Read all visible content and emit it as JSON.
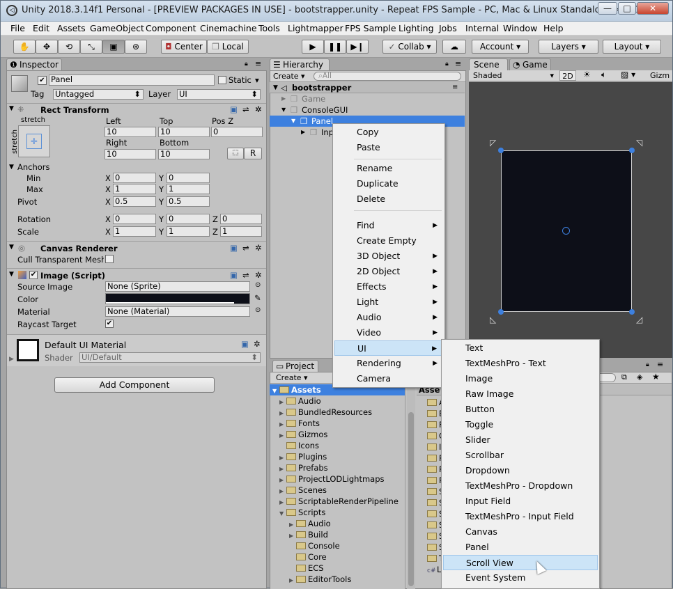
{
  "window": {
    "title": "Unity 2018.3.14f1 Personal - [PREVIEW PACKAGES IN USE] - bootstrapper.unity - Repeat FPS Sample - PC, Mac & Linux Standalone <DX11>",
    "controls": [
      "—",
      "□",
      "✕"
    ]
  },
  "menubar": [
    "File",
    "Edit",
    "Assets",
    "GameObject",
    "Component",
    "Cinemachine",
    "Tools",
    "Lightmapper",
    "FPS Sample",
    "Lighting",
    "Jobs",
    "Internal",
    "Window",
    "Help"
  ],
  "toolbar": {
    "center": "Center",
    "local": "Local",
    "collab": "Collab",
    "account": "Account",
    "layers": "Layers",
    "layout": "Layout"
  },
  "inspector": {
    "tab": "Inspector",
    "object_name": "Panel",
    "static_label": "Static",
    "tag_label": "Tag",
    "tag_value": "Untagged",
    "layer_label": "Layer",
    "layer_value": "UI",
    "rect_transform": {
      "title": "Rect Transform",
      "stretch_h": "stretch",
      "stretch_v": "stretch",
      "left_label": "Left",
      "top_label": "Top",
      "posz_label": "Pos Z",
      "left": "10",
      "top": "10",
      "posz": "0",
      "right_label": "Right",
      "bottom_label": "Bottom",
      "right": "10",
      "bottom": "10",
      "r_button": "R",
      "anchors": "Anchors",
      "min": "Min",
      "max": "Max",
      "min_x": "0",
      "min_y": "0",
      "max_x": "1",
      "max_y": "1",
      "pivot": "Pivot",
      "pivot_x": "0.5",
      "pivot_y": "0.5",
      "rotation": "Rotation",
      "rot_x": "0",
      "rot_y": "0",
      "rot_z": "0",
      "scale": "Scale",
      "scale_x": "1",
      "scale_y": "1",
      "scale_z": "1",
      "x": "X",
      "y": "Y",
      "z": "Z"
    },
    "canvas_renderer": {
      "title": "Canvas Renderer",
      "cull": "Cull Transparent Mesh"
    },
    "image": {
      "title": "Image (Script)",
      "source_image": "Source Image",
      "source_value": "None (Sprite)",
      "color": "Color",
      "material": "Material",
      "material_value": "None (Material)",
      "raycast": "Raycast Target"
    },
    "material": {
      "name": "Default UI Material",
      "shader_label": "Shader",
      "shader_value": "UI/Default"
    },
    "add_component": "Add Component"
  },
  "hierarchy": {
    "tab": "Hierarchy",
    "create": "Create",
    "search_placeholder": "All",
    "scene": "bootstrapper",
    "items": [
      "Game",
      "ConsoleGUI",
      "Panel",
      "Inp"
    ]
  },
  "scene": {
    "tab_scene": "Scene",
    "tab_game": "Game",
    "shading": "Shaded",
    "mode_2d": "2D",
    "gizmos": "Gizm"
  },
  "project": {
    "tab": "Project",
    "create": "Create",
    "assets": "Assets",
    "assets_right": "Asse",
    "folders": [
      "Audio",
      "BundledResources",
      "Fonts",
      "Gizmos",
      "Icons",
      "Plugins",
      "Prefabs",
      "ProjectLODLightmaps",
      "Scenes",
      "ScriptableRenderPipeline",
      "Scripts",
      "Audio",
      "Build",
      "Console",
      "Core",
      "ECS",
      "EditorTools"
    ],
    "right_items": [
      "A",
      "B",
      "F",
      "G",
      "I",
      "P",
      "P",
      "P",
      "S",
      "S",
      "S",
      "S",
      "S",
      "S",
      "T",
      "L"
    ]
  },
  "context_menu": {
    "items": [
      "Copy",
      "Paste",
      "Rename",
      "Duplicate",
      "Delete",
      "Find",
      "Create Empty",
      "3D Object",
      "2D Object",
      "Effects",
      "Light",
      "Audio",
      "Video",
      "UI",
      "Rendering",
      "Camera"
    ]
  },
  "ui_submenu": {
    "items": [
      "Text",
      "TextMeshPro - Text",
      "Image",
      "Raw Image",
      "Button",
      "Toggle",
      "Slider",
      "Scrollbar",
      "Dropdown",
      "TextMeshPro - Dropdown",
      "Input Field",
      "TextMeshPro - Input Field",
      "Canvas",
      "Panel",
      "Scroll View",
      "Event System"
    ],
    "highlighted": "Scroll View"
  },
  "colors": {
    "selection": "#3d80df",
    "menu_highlight": "#cce4f7",
    "panel_bg": "#c2c2c2",
    "scene_bg": "#474747"
  }
}
